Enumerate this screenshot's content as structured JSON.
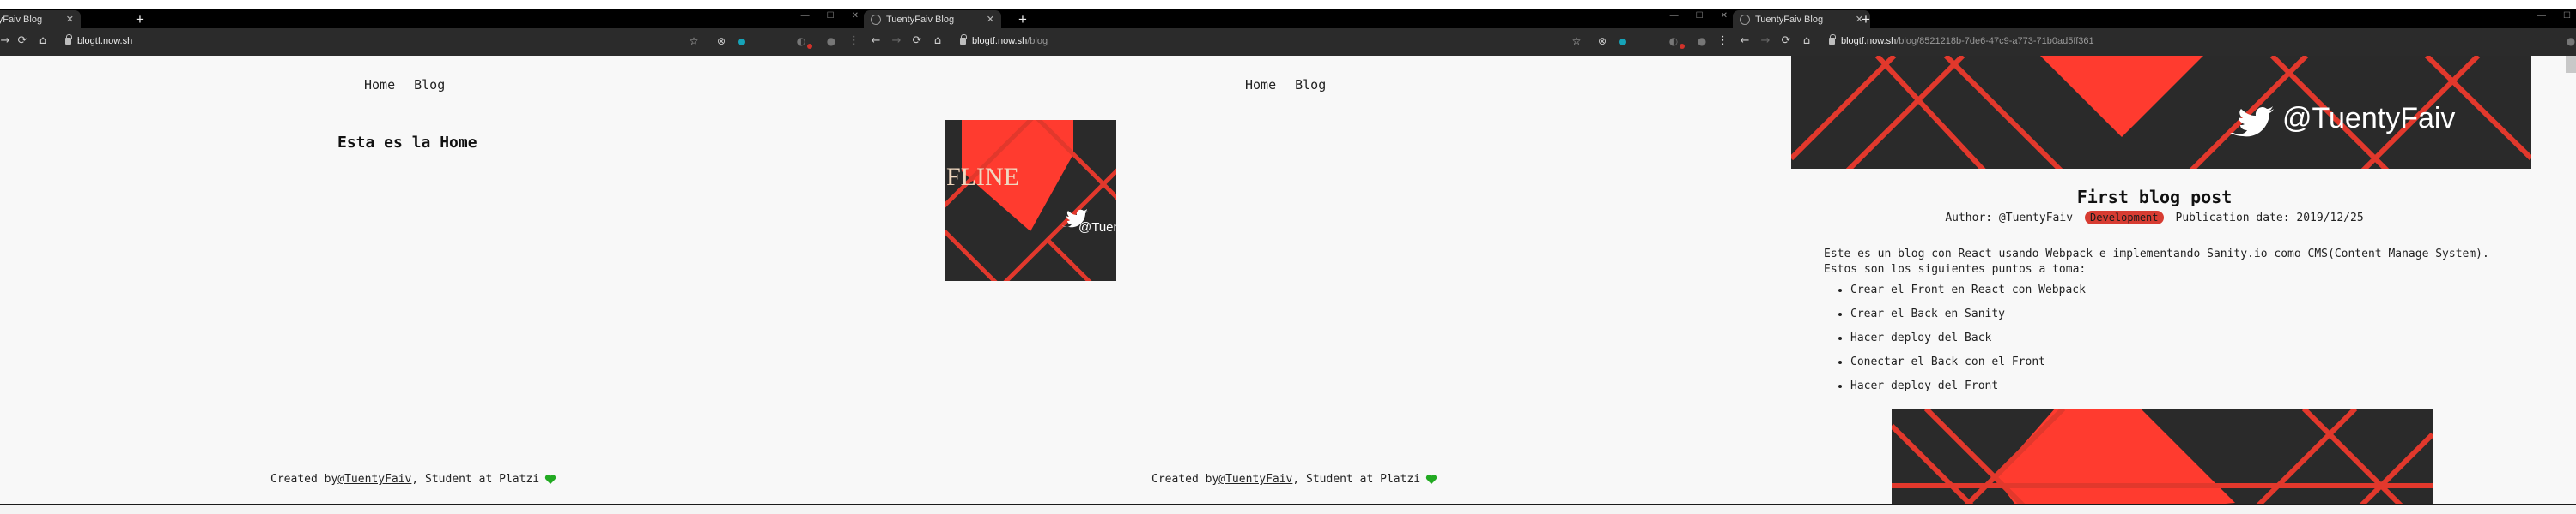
{
  "windows": [
    {
      "tab_title": "TuentyFaiv Blog",
      "url_host": "blogtf.now.sh",
      "url_path": "",
      "nav": [
        "Home",
        "Blog"
      ],
      "page_title": "Esta es la Home",
      "footer": {
        "prefix": "Created by ",
        "link": "@TuentyFaiv",
        "suffix": ", Student at Platzi"
      }
    },
    {
      "tab_title": "TuentyFaiv Blog",
      "url_host": "blogtf.now.sh",
      "url_path": "/blog",
      "nav": [
        "Home",
        "Blog"
      ],
      "card": {
        "overlay_text": "FLINE",
        "handle": "@Tuent"
      },
      "footer": {
        "prefix": "Created by ",
        "link": "@TuentyFaiv",
        "suffix": ", Student at Platzi"
      }
    },
    {
      "tab_title": "TuentyFaiv Blog",
      "url_host": "blogtf.now.sh",
      "url_path": "/blog/8521218b-7de6-47c9-a773-71b0ad5ff361",
      "hero_handle": "@TuentyFaiv",
      "post": {
        "title": "First blog post",
        "author": "Author: @TuentyFaiv",
        "tag": "Development",
        "date": "Publication date: 2019/12/25",
        "intro": "Este es un blog con React usando Webpack e implementando Sanity.io como CMS(Content Manage System). Estos son los siguientes puntos a toma:",
        "bullets": [
          "Crear el Front en React con Webpack",
          "Crear el Back en Sanity",
          "Hacer deploy del Back",
          "Conectar el Back con el Front",
          "Hacer deploy del Front"
        ]
      }
    }
  ],
  "colors": {
    "accent": "#ff3b2f",
    "dark": "#2a2a2a",
    "badge": "#d73c32",
    "heart": "#22aa22"
  },
  "icons": [
    "back-icon",
    "forward-icon",
    "reload-icon",
    "home-icon",
    "lock-icon",
    "star-icon",
    "twitter-bird-icon",
    "heart-icon",
    "new-tab-icon",
    "menu-icon"
  ]
}
